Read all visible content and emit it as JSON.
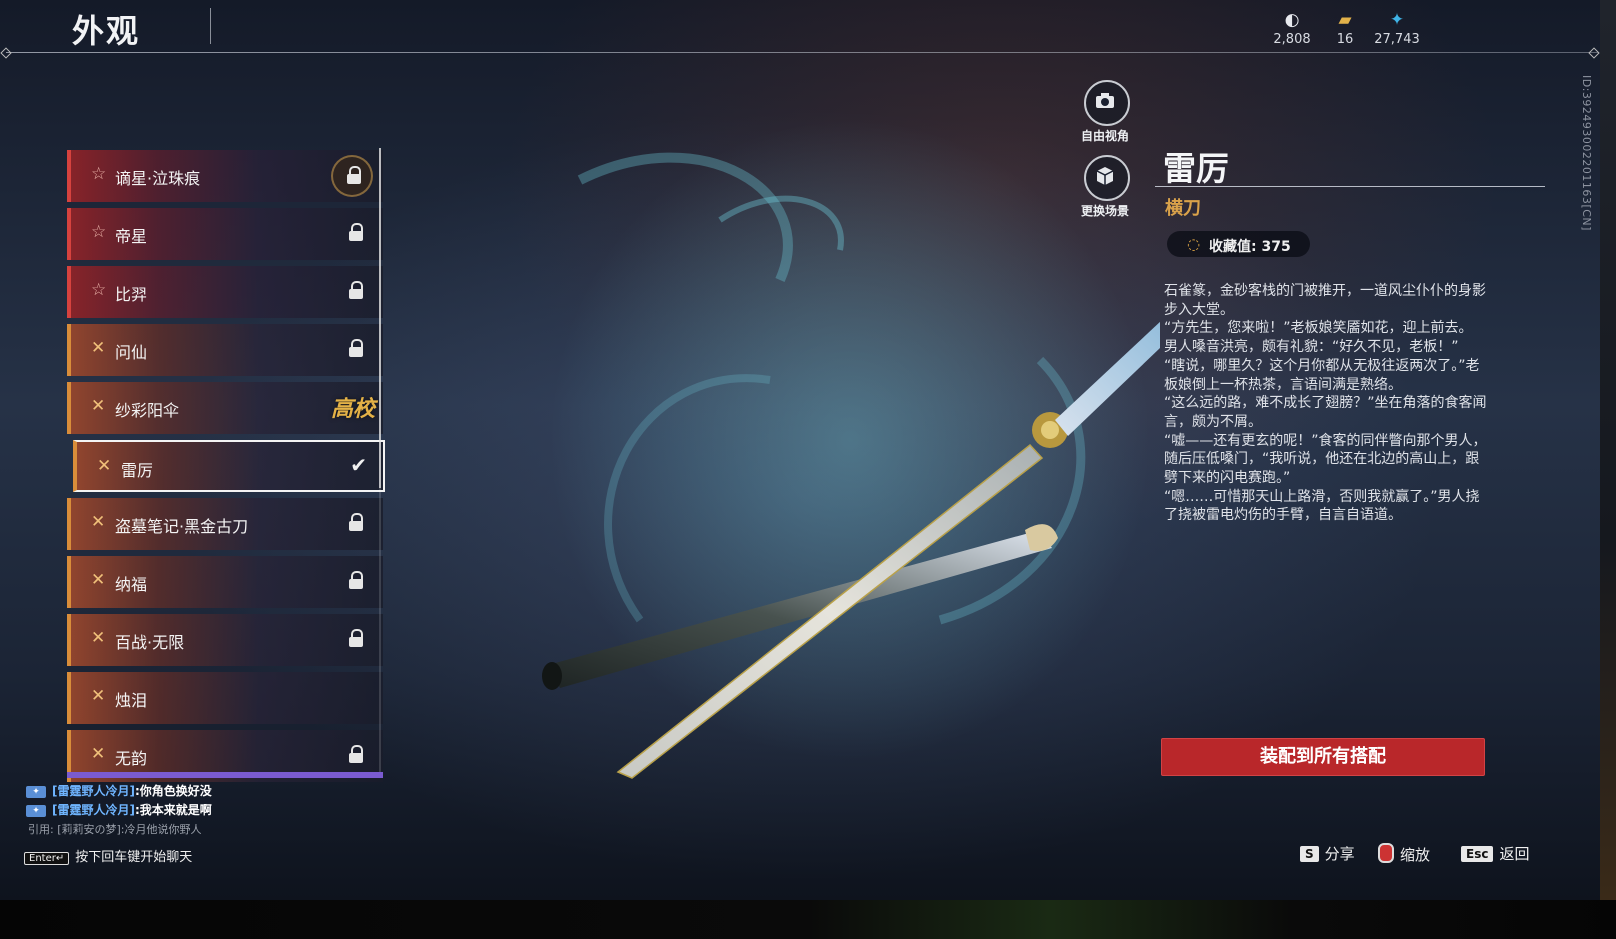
{
  "header": {
    "title": "外观",
    "currencies": [
      {
        "icon": "coin-stack-icon",
        "value": "2,808"
      },
      {
        "icon": "gold-ticket-icon",
        "value": "16"
      },
      {
        "icon": "feather-icon",
        "value": "27,743"
      }
    ]
  },
  "side_id": "ID:392493002201163[CN]",
  "list": {
    "items": [
      {
        "label": "谪星·泣珠痕",
        "rarity": "red",
        "state": "locked-ring"
      },
      {
        "label": "帝星",
        "rarity": "red",
        "state": "locked"
      },
      {
        "label": "比羿",
        "rarity": "red",
        "state": "locked"
      },
      {
        "label": "问仙",
        "rarity": "orange",
        "state": "locked"
      },
      {
        "label": "纱彩阳伞",
        "rarity": "orange",
        "state": "badge",
        "badge": "高校"
      },
      {
        "label": "雷厉",
        "rarity": "orange",
        "state": "selected"
      },
      {
        "label": "盗墓笔记·黑金古刀",
        "rarity": "orange",
        "state": "locked"
      },
      {
        "label": "纳福",
        "rarity": "orange",
        "state": "locked"
      },
      {
        "label": "百战·无限",
        "rarity": "orange",
        "state": "locked"
      },
      {
        "label": "烛泪",
        "rarity": "orange",
        "state": "none"
      },
      {
        "label": "无韵",
        "rarity": "orange",
        "state": "locked"
      }
    ]
  },
  "view_buttons": {
    "free_view": "自由视角",
    "change_scene": "更换场景"
  },
  "detail": {
    "name": "雷厉",
    "type": "横刀",
    "collect_label": "收藏值: 375",
    "lore": [
      "石雀篆，金砂客栈的门被推开，一道风尘仆仆的身影步入大堂。",
      "“方先生，您来啦！”老板娘笑靥如花，迎上前去。",
      "男人嗓音洪亮，颇有礼貌：“好久不见，老板！”",
      "“瞎说，哪里久？这个月你都从无极往返两次了。”老板娘倒上一杯热茶，言语间满是熟络。",
      "“这么远的路，难不成长了翅膀？”坐在角落的食客闻言，颇为不屑。",
      "“嘘——还有更玄的呢！”食客的同伴瞥向那个男人，随后压低嗓门，“我听说，他还在北边的高山上，跟劈下来的闪电赛跑。”",
      "“嗯……可惜那天山上路滑，否则我就赢了。”男人挠了挠被雷电灼伤的手臂，自言自语道。"
    ],
    "equip_button": "装配到所有搭配"
  },
  "chat": {
    "lines": [
      {
        "name": "[雷霆野人冷月]",
        "msg": ":你角色换好没"
      },
      {
        "name": "[雷霆野人冷月]",
        "msg": ":我本来就是啊"
      }
    ],
    "quote": "引用: [莉莉安の梦]:冷月他说你野人",
    "enter_key": "Enter↵",
    "enter_hint": "按下回车键开始聊天"
  },
  "hotkeys": {
    "share_key": "S",
    "share_label": "分享",
    "zoom_label": "缩放",
    "back_key": "Esc",
    "back_label": "返回"
  },
  "colors": {
    "accent_red": "#b9272a",
    "rarity_red": "#d6423e",
    "rarity_orange": "#d98d3a",
    "gold_text": "#d9a24a"
  }
}
